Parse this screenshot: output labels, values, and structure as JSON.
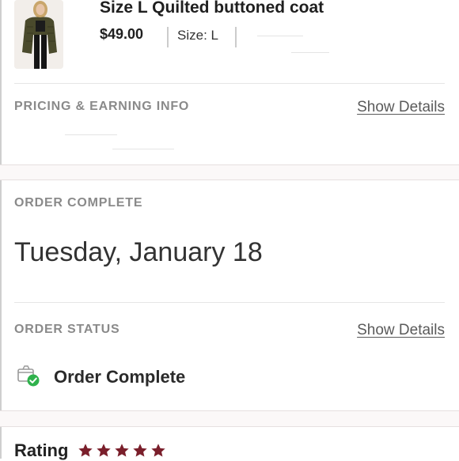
{
  "product": {
    "title": "Size L Quilted buttoned coat",
    "price": "$49.00",
    "size": "Size: L"
  },
  "pricing": {
    "heading": "PRICING & EARNING INFO",
    "link": "Show Details"
  },
  "order_complete": {
    "heading": "ORDER COMPLETE",
    "date": "Tuesday, January 18"
  },
  "order_status": {
    "heading": "ORDER STATUS",
    "link": "Show Details",
    "status": "Order Complete",
    "status_icon": "package-check-icon"
  },
  "rating": {
    "label": "Rating",
    "stars": 5,
    "star_color": "#7a1f2b"
  },
  "colors": {
    "accent_green": "#2fb24c",
    "section_band": "#fbf8f8"
  }
}
